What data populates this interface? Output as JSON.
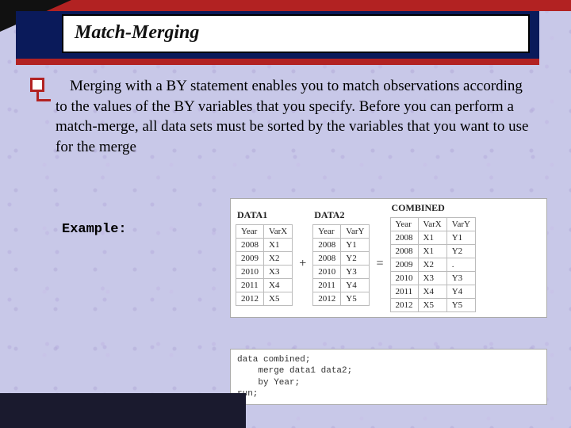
{
  "slide": {
    "title": "Match-Merging",
    "body": "Merging with a BY statement enables you to match observations according to the values of the BY variables that you specify. Before you can perform a match-merge, all data sets must be sorted by the variables that you want to use for the merge",
    "example_label": "Example:"
  },
  "tables": {
    "data1": {
      "name": "DATA1",
      "cols": [
        "Year",
        "VarX"
      ],
      "rows": [
        [
          "2008",
          "X1"
        ],
        [
          "2009",
          "X2"
        ],
        [
          "2010",
          "X3"
        ],
        [
          "2011",
          "X4"
        ],
        [
          "2012",
          "X5"
        ]
      ]
    },
    "data2": {
      "name": "DATA2",
      "cols": [
        "Year",
        "VarY"
      ],
      "rows": [
        [
          "2008",
          "Y1"
        ],
        [
          "2008",
          "Y2"
        ],
        [
          "2010",
          "Y3"
        ],
        [
          "2011",
          "Y4"
        ],
        [
          "2012",
          "Y5"
        ]
      ]
    },
    "combined": {
      "name": "COMBINED",
      "cols": [
        "Year",
        "VarX",
        "VarY"
      ],
      "rows": [
        [
          "2008",
          "X1",
          "Y1"
        ],
        [
          "2008",
          "X1",
          "Y2"
        ],
        [
          "2009",
          "X2",
          "."
        ],
        [
          "2010",
          "X3",
          "Y3"
        ],
        [
          "2011",
          "X4",
          "Y4"
        ],
        [
          "2012",
          "X5",
          "Y5"
        ]
      ]
    },
    "plus": "+",
    "equals": "="
  },
  "code": {
    "line1": "data combined;",
    "line2": "    merge data1 data2;",
    "line3": "    by Year;",
    "line4": "run;"
  }
}
